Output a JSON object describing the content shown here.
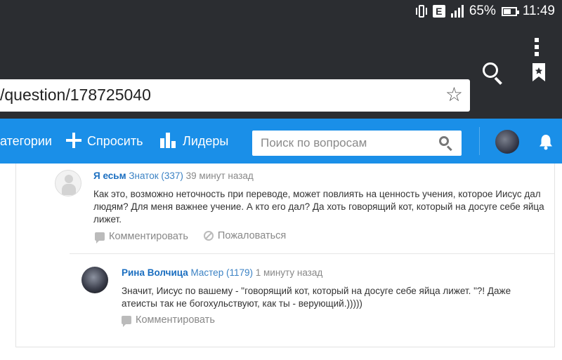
{
  "status_bar": {
    "battery": "65%",
    "battery_level": 0.65,
    "time": "11:49",
    "network_badge": "E",
    "icons": [
      "vibrate-icon",
      "network-e-icon",
      "signal-icon",
      "battery-icon"
    ]
  },
  "browser": {
    "url": "/question/178725040",
    "icons": [
      "star-icon",
      "search-icon",
      "bookmark-icon",
      "menu-icon"
    ]
  },
  "site_nav": {
    "categories": "атегории",
    "ask": "Спросить",
    "leaders": "Лидеры",
    "search_placeholder": "Поиск по вопросам",
    "accent_color": "#1a8fe8"
  },
  "comments": [
    {
      "author": "Я есьм",
      "rank": "Знаток (337)",
      "time": "39 минут назад",
      "text": "Как это, возможно неточность при переводе, может повлиять на ценность учения, которое Иисус дал людям? Для меня важнее учение. А кто его дал? Да хоть говорящий кот, который на досуге себе яйца лижет.",
      "comment_label": "Комментировать",
      "report_label": "Пожаловаться"
    },
    {
      "author": "Рина Волчица",
      "rank": "Мастер (1179)",
      "time": "1 минуту назад",
      "text": "Значит, Иисус по вашему - \"говорящий кот, который на досуге себе яйца лижет. \"?! Даже атеисты так не богохульствуют, как ты - верующий.)))))",
      "comment_label": "Комментировать"
    }
  ]
}
